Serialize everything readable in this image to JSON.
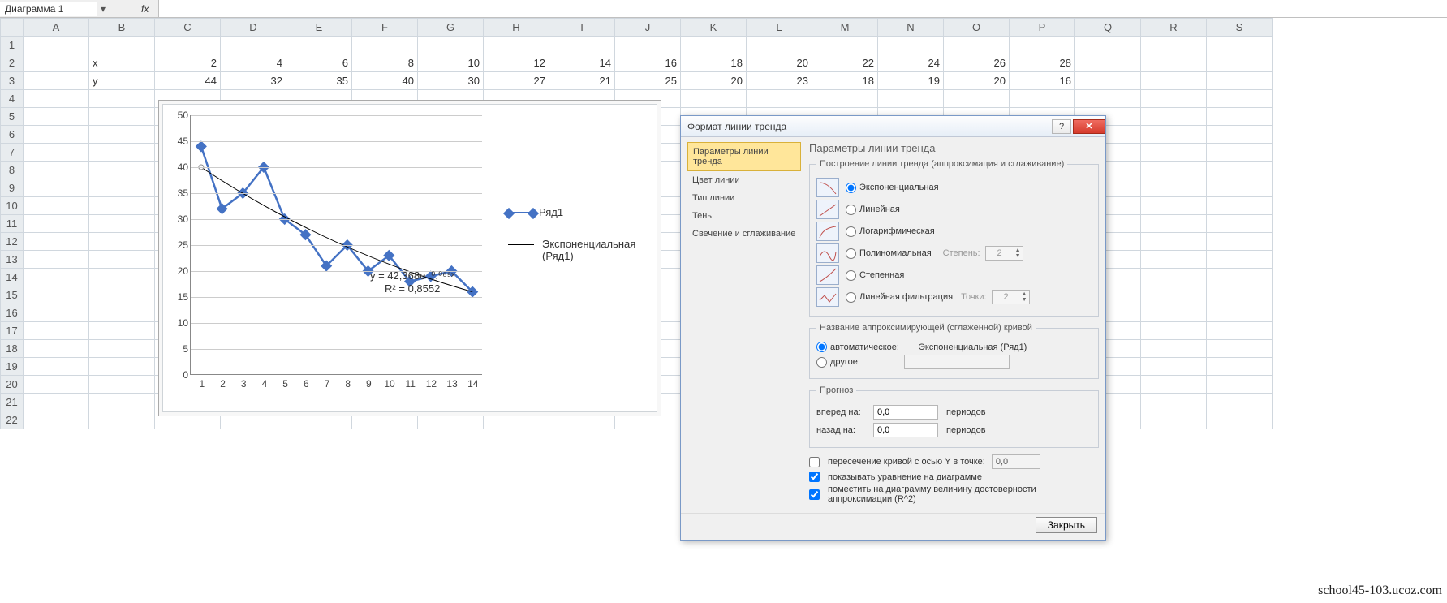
{
  "name_box": "Диаграмма 1",
  "fx_label": "fx",
  "formula": "",
  "columns": [
    "A",
    "B",
    "C",
    "D",
    "E",
    "F",
    "G",
    "H",
    "I",
    "J",
    "K",
    "L",
    "M",
    "N",
    "O",
    "P",
    "Q",
    "R",
    "S"
  ],
  "row_count": 22,
  "cells": {
    "B2": "x",
    "C2": "2",
    "D2": "4",
    "E2": "6",
    "F2": "8",
    "G2": "10",
    "H2": "12",
    "I2": "14",
    "J2": "16",
    "K2": "18",
    "L2": "20",
    "M2": "22",
    "N2": "24",
    "O2": "26",
    "P2": "28",
    "B3": "y",
    "C3": "44",
    "D3": "32",
    "E3": "35",
    "F3": "40",
    "G3": "30",
    "H3": "27",
    "I3": "21",
    "J3": "25",
    "K3": "20",
    "L3": "23",
    "M3": "18",
    "N3": "19",
    "O3": "20",
    "P3": "16"
  },
  "chart_data": {
    "type": "line",
    "categories": [
      1,
      2,
      3,
      4,
      5,
      6,
      7,
      8,
      9,
      10,
      11,
      12,
      13,
      14
    ],
    "series": [
      {
        "name": "Ряд1",
        "values": [
          44,
          32,
          35,
          40,
          30,
          27,
          21,
          25,
          20,
          23,
          18,
          19,
          20,
          16
        ]
      }
    ],
    "trendline": {
      "type": "exponential",
      "name": "Экспоненциальная (Ряд1)",
      "equation": "y = 42,368e⁻⁰,⁰⁶⁹ˣ",
      "r2": "R² = 0,8552"
    },
    "ylim": [
      0,
      50
    ],
    "ystep": 5,
    "xlabel": "",
    "ylabel": ""
  },
  "legend": {
    "series": "Ряд1",
    "trend_line1": "Экспоненциальная",
    "trend_line2": "(Ряд1)"
  },
  "dialog": {
    "title": "Формат линии тренда",
    "tabs": [
      "Параметры линии тренда",
      "Цвет линии",
      "Тип линии",
      "Тень",
      "Свечение и сглаживание"
    ],
    "pane_title": "Параметры линии тренда",
    "group_build": "Построение линии тренда (аппроксимация и сглаживание)",
    "types": {
      "exp": "Экспоненциальная",
      "lin": "Линейная",
      "log": "Логарифмическая",
      "poly": "Полиномиальная",
      "pow": "Степенная",
      "mavg": "Линейная фильтрация"
    },
    "degree_label": "Степень:",
    "degree_value": "2",
    "points_label": "Точки:",
    "points_value": "2",
    "group_name": "Название аппроксимирующей (сглаженной) кривой",
    "name_auto": "автоматическое:",
    "name_auto_value": "Экспоненциальная (Ряд1)",
    "name_other": "другое:",
    "name_other_value": "",
    "group_forecast": "Прогноз",
    "forward": "вперед на:",
    "forward_value": "0,0",
    "backward": "назад на:",
    "backward_value": "0,0",
    "periods": "периодов",
    "intercept": "пересечение кривой с осью Y в точке:",
    "intercept_value": "0,0",
    "show_eq": "показывать уравнение на диаграмме",
    "show_r2": "поместить на диаграмму величину достоверности аппроксимации (R^2)",
    "close": "Закрыть"
  },
  "watermark": "school45-103.ucoz.com"
}
